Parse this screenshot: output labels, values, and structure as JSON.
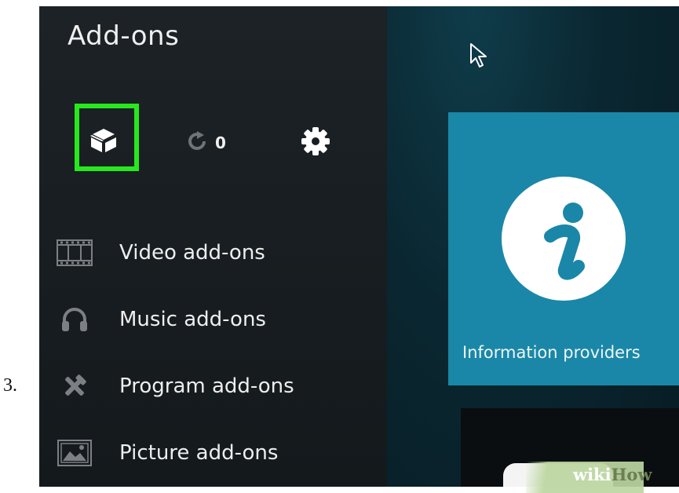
{
  "step": {
    "number": "3."
  },
  "header": {
    "title": "Add-ons"
  },
  "toolbar": {
    "addon_browser_icon": "open-box-icon",
    "update_icon": "refresh-icon",
    "update_count": "0",
    "settings_icon": "gear-icon",
    "highlight_color": "#27e81e"
  },
  "menu": {
    "items": [
      {
        "label": "Video add-ons",
        "icon": "film-strip-icon"
      },
      {
        "label": "Music add-ons",
        "icon": "headphones-icon"
      },
      {
        "label": "Program add-ons",
        "icon": "tools-icon"
      },
      {
        "label": "Picture add-ons",
        "icon": "picture-icon"
      }
    ]
  },
  "content": {
    "tile": {
      "label": "Information providers",
      "icon": "info-icon",
      "color": "#1a87a8"
    }
  },
  "watermark": {
    "prefix": "wiki",
    "suffix": "How"
  }
}
